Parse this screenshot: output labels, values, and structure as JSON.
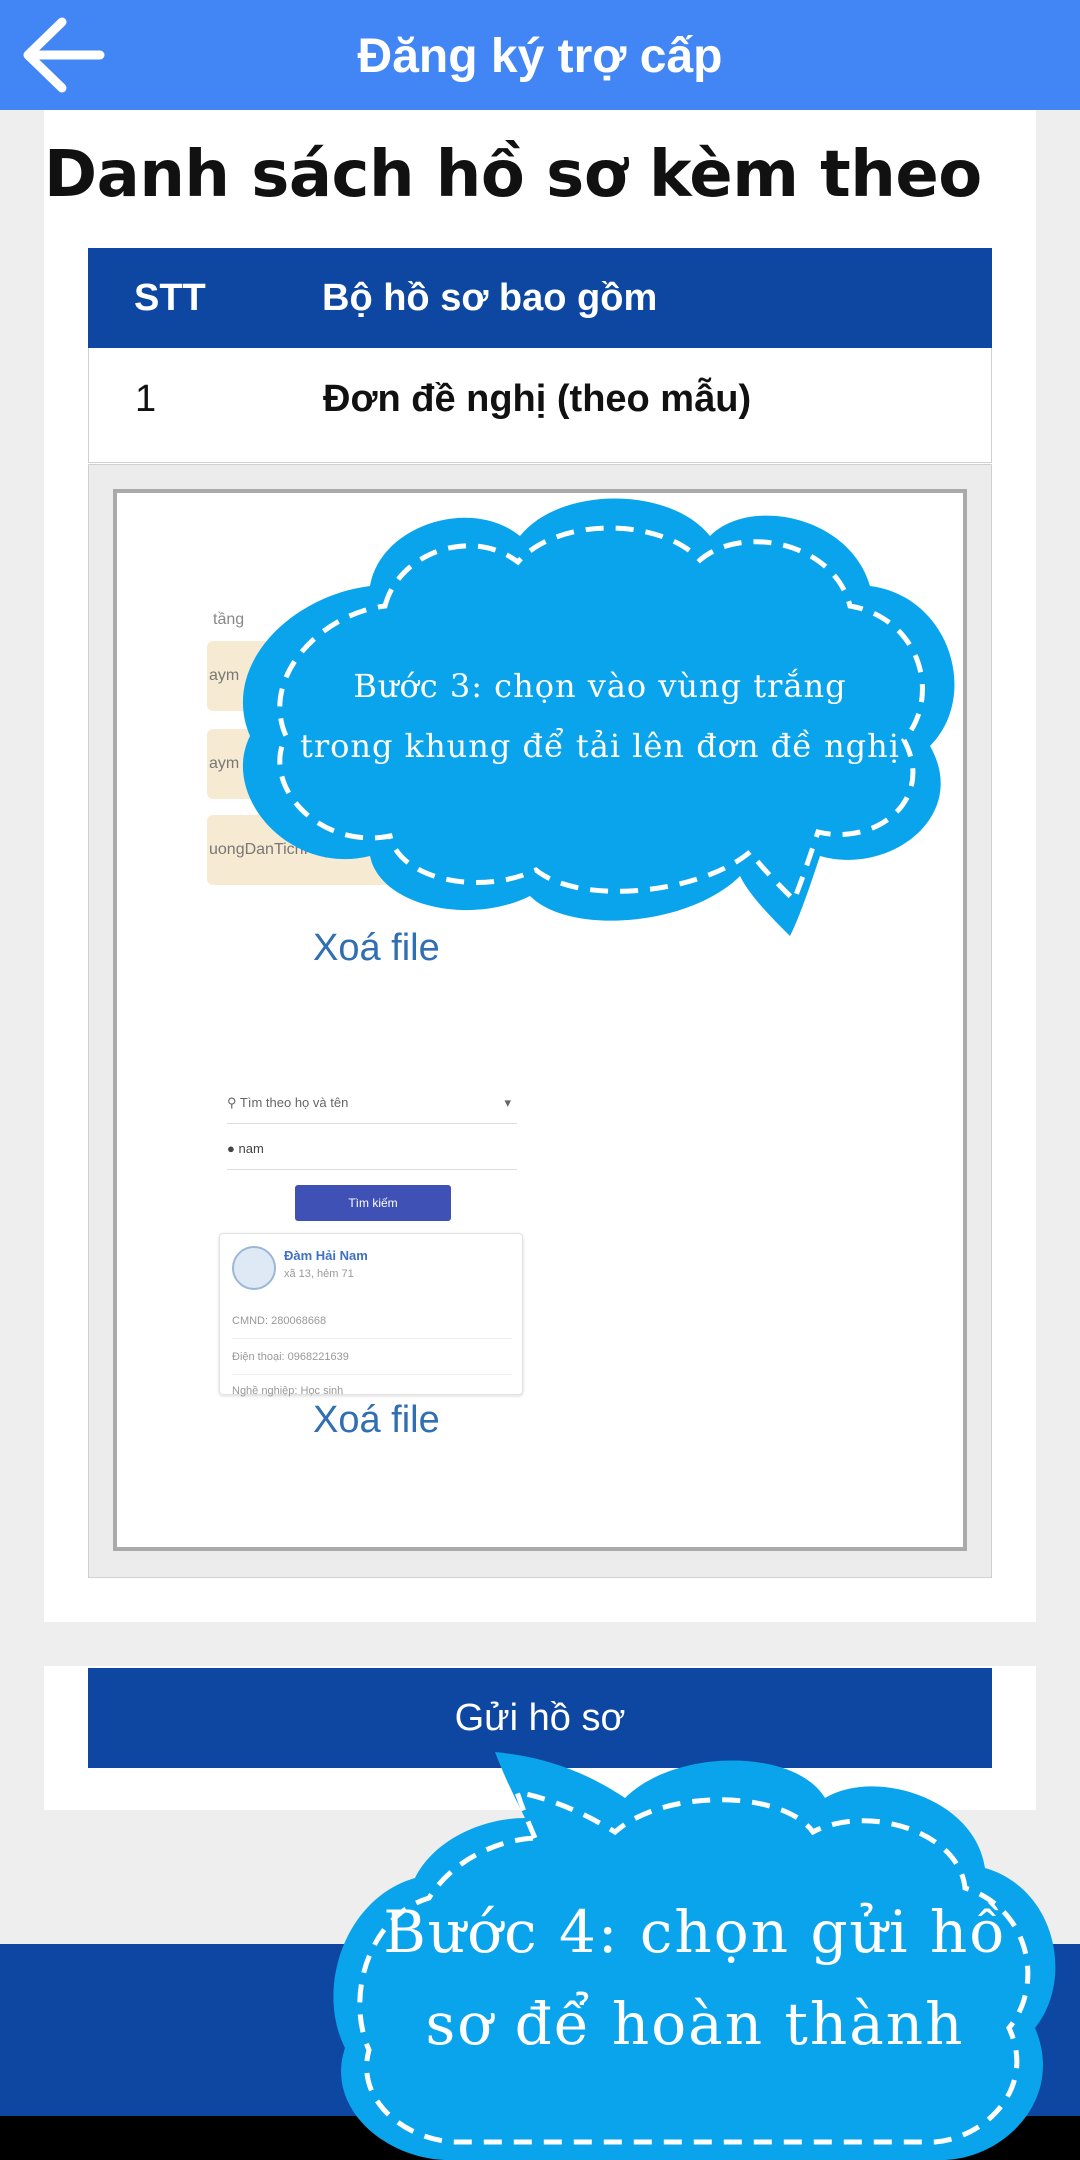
{
  "appbar": {
    "title": "Đăng ký trợ cấp",
    "back_icon": "arrow-left-icon"
  },
  "section": {
    "title": "Danh sách hồ sơ kèm theo"
  },
  "table": {
    "headers": {
      "stt": "STT",
      "documents": "Bộ hồ sơ bao gồm"
    },
    "rows": [
      {
        "stt": "1",
        "document": "Đơn đề nghị (theo mẫu)"
      }
    ]
  },
  "uploads": {
    "files": [
      {
        "delete_label": "Xoá file",
        "thumbnail": {
          "top_text": "tầng",
          "strip1": "aym",
          "strip2": "aym",
          "strip3": "uongDanTichHop_PaymentH"
        }
      },
      {
        "delete_label": "Xoá file",
        "thumbnail": {
          "search_placeholder": "Tìm theo họ và tên",
          "user_value": "nam",
          "search_button": "Tìm kiếm",
          "name": "Đàm Hải Nam",
          "address": "xã 13, hẻm 71",
          "id_line": "CMND: 280068668",
          "phone_line": "Điện thoại: 0968221639",
          "job_line": "Nghề nghiệp: Học sinh"
        }
      }
    ]
  },
  "annotations": {
    "step3_line1": "Bước 3: chọn vào vùng trắng",
    "step3_line2": "trong khung để tải lên đơn đề nghị",
    "step4_line1": "Bước 4: chọn gửi hồ",
    "step4_line2": "sơ để hoàn thành"
  },
  "actions": {
    "submit_label": "Gửi hồ sơ"
  },
  "colors": {
    "appbar": "#4285f4",
    "primary": "#0d47a1",
    "link": "#2f6fb2",
    "cloud": "#0aa4ec"
  }
}
